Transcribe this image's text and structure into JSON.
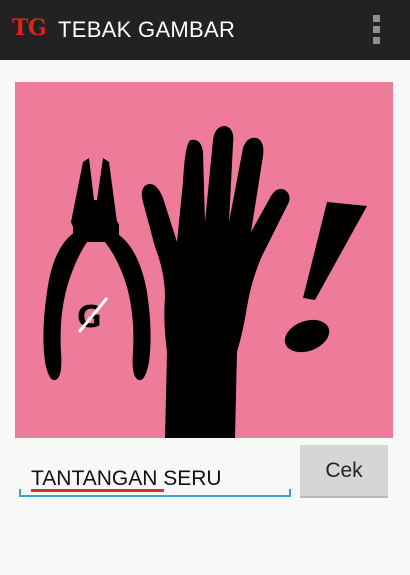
{
  "action_bar": {
    "logo_text": "TG",
    "title": "TEBAK GAMBAR",
    "menu_icon": "overflow-menu-icon"
  },
  "puzzle": {
    "background_color": "#ef7b9b",
    "pictograms": [
      "pliers-icon",
      "raised-hand-icon",
      "exclamation-icon"
    ],
    "watermark_text": "G"
  },
  "answer": {
    "value": "TANTANGAN SERU",
    "accent_color": "#33a6cc"
  },
  "check_button": {
    "label": "Cek"
  }
}
